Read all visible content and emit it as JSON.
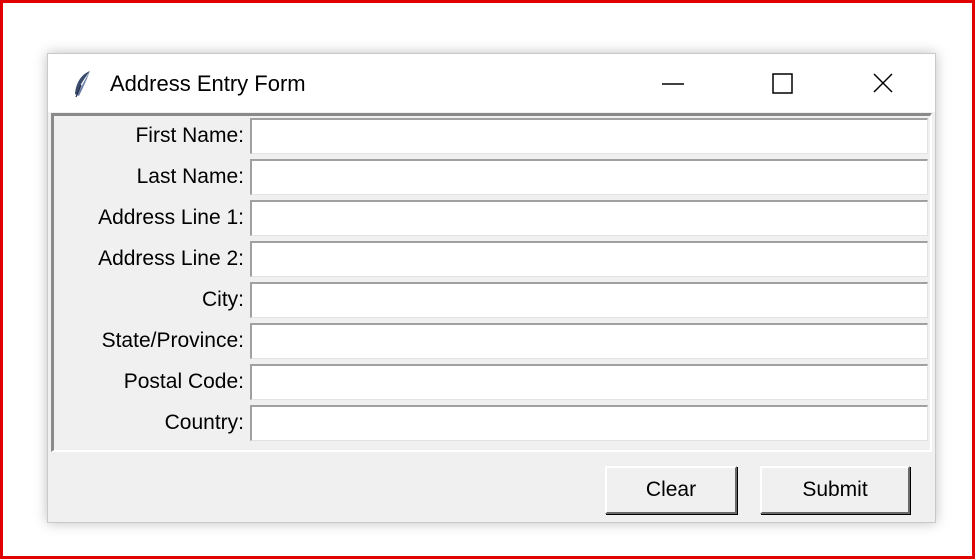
{
  "window": {
    "title": "Address Entry Form"
  },
  "form": {
    "fields": [
      {
        "label": "First Name:",
        "value": ""
      },
      {
        "label": "Last Name:",
        "value": ""
      },
      {
        "label": "Address Line 1:",
        "value": ""
      },
      {
        "label": "Address Line 2:",
        "value": ""
      },
      {
        "label": "City:",
        "value": ""
      },
      {
        "label": "State/Province:",
        "value": ""
      },
      {
        "label": "Postal Code:",
        "value": ""
      },
      {
        "label": "Country:",
        "value": ""
      }
    ]
  },
  "buttons": {
    "clear_label": "Clear",
    "submit_label": "Submit"
  },
  "icons": {
    "app": "feather-icon",
    "minimize": "minimize-icon",
    "maximize": "maximize-icon",
    "close": "close-icon"
  },
  "colors": {
    "highlight_border": "#e00000",
    "window_bg": "#f0f0f0",
    "field_bg": "#ffffff"
  }
}
